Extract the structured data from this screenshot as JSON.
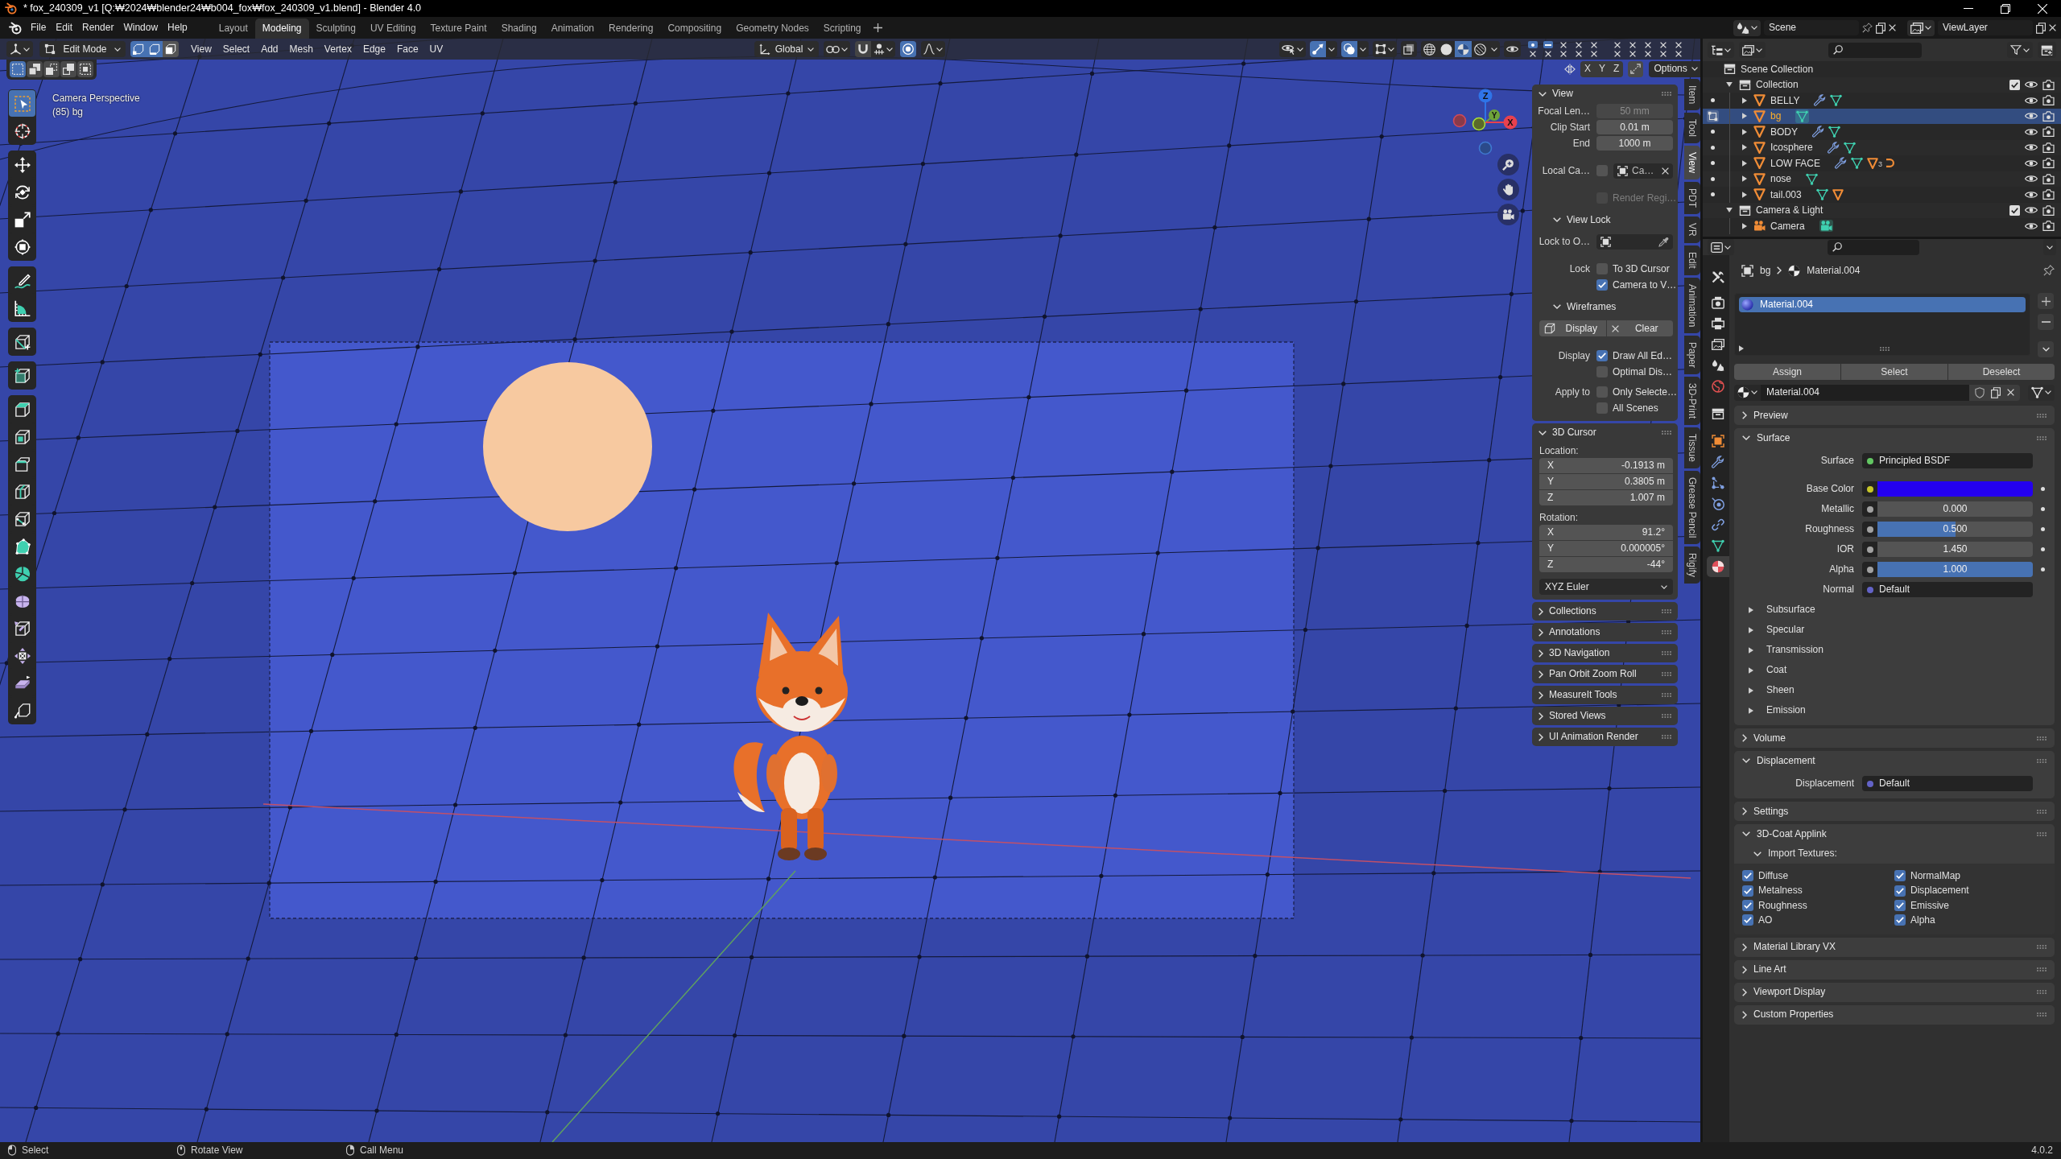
{
  "window": {
    "title": "* fox_240309_v1 [Q:₩2024₩blender24₩b004_fox₩fox_240309_v1.blend] - Blender 4.0"
  },
  "menu": [
    "File",
    "Edit",
    "Render",
    "Window",
    "Help"
  ],
  "workspaces": [
    {
      "label": "Layout",
      "selected": false
    },
    {
      "label": "Modeling",
      "selected": true
    },
    {
      "label": "Sculpting",
      "selected": false
    },
    {
      "label": "UV Editing",
      "selected": false
    },
    {
      "label": "Texture Paint",
      "selected": false
    },
    {
      "label": "Shading",
      "selected": false
    },
    {
      "label": "Animation",
      "selected": false
    },
    {
      "label": "Rendering",
      "selected": false
    },
    {
      "label": "Compositing",
      "selected": false
    },
    {
      "label": "Geometry Nodes",
      "selected": false
    },
    {
      "label": "Scripting",
      "selected": false
    }
  ],
  "scene": {
    "name": "Scene"
  },
  "view_layer": {
    "name": "ViewLayer"
  },
  "viewport": {
    "header": {
      "mode": "Edit Mode",
      "select_modes": [
        {
          "kind": "vertex",
          "selected": true
        },
        {
          "kind": "edge",
          "selected": true
        },
        {
          "kind": "face",
          "selected": false
        }
      ],
      "menus": [
        "View",
        "Select",
        "Add",
        "Mesh",
        "Vertex",
        "Edge",
        "Face",
        "UV"
      ],
      "orientation": "Global",
      "snapping": false,
      "proportional_editing": true,
      "gizmos": true,
      "overlays": true,
      "xray": false,
      "shading_modes": [
        {
          "kind": "wireframe",
          "selected": false
        },
        {
          "kind": "solid",
          "selected": false
        },
        {
          "kind": "material",
          "selected": true
        },
        {
          "kind": "rendered",
          "selected": false
        }
      ],
      "qcd_slots": [
        {
          "kind": "active"
        },
        {
          "kind": "occupied"
        },
        {
          "kind": "empty"
        },
        {
          "kind": "empty"
        },
        {
          "kind": "empty"
        },
        {
          "kind": "empty"
        },
        {
          "kind": "empty"
        },
        {
          "kind": "empty"
        },
        {
          "kind": "empty"
        },
        {
          "kind": "empty"
        },
        {
          "kind": "empty"
        },
        {
          "kind": "empty"
        },
        {
          "kind": "empty"
        },
        {
          "kind": "empty"
        },
        {
          "kind": "empty"
        },
        {
          "kind": "empty"
        },
        {
          "kind": "empty"
        },
        {
          "kind": "empty"
        },
        {
          "kind": "empty"
        },
        {
          "kind": "empty"
        }
      ]
    },
    "tool_header": {
      "select_ops": [
        {
          "kind": "set",
          "selected": true
        },
        {
          "kind": "extend",
          "selected": false
        },
        {
          "kind": "subtract",
          "selected": false
        },
        {
          "kind": "invert",
          "selected": false
        },
        {
          "kind": "intersect",
          "selected": false
        }
      ],
      "mirror_axes": [
        {
          "label": "X",
          "selected": false
        },
        {
          "label": "Y",
          "selected": false
        },
        {
          "label": "Z",
          "selected": false
        }
      ],
      "options": "Options"
    },
    "view_name": "Camera Perspective",
    "object_info": "(85) bg",
    "gizmo": {
      "axes": [
        {
          "label": "Z",
          "color": "#2f74e8"
        },
        {
          "label": "Y",
          "color": "#6ea33a"
        },
        {
          "label": "X",
          "color": "#e8414e"
        }
      ]
    },
    "tool_groups": [
      [
        {
          "kind": "select_box",
          "selected": true
        },
        {
          "kind": "cursor",
          "selected": false
        }
      ],
      [
        {
          "kind": "move",
          "selected": false
        },
        {
          "kind": "rotate",
          "selected": false
        },
        {
          "kind": "scale",
          "selected": false
        },
        {
          "kind": "transform",
          "selected": false
        }
      ],
      [
        {
          "kind": "annotate",
          "selected": false
        },
        {
          "kind": "measure",
          "selected": false
        }
      ],
      [
        {
          "kind": "cube_edit",
          "selected": false
        }
      ],
      [
        {
          "kind": "add_cube",
          "selected": false
        }
      ],
      [
        {
          "kind": "extrude",
          "selected": false
        },
        {
          "kind": "inset",
          "selected": false
        },
        {
          "kind": "bevel",
          "selected": false
        },
        {
          "kind": "loop_cut",
          "selected": false
        },
        {
          "kind": "knife",
          "selected": false
        },
        {
          "kind": "poly_build",
          "selected": false
        },
        {
          "kind": "spin",
          "selected": false
        },
        {
          "kind": "smooth",
          "selected": false
        },
        {
          "kind": "edge_slide",
          "selected": false
        },
        {
          "kind": "shrink",
          "selected": false
        },
        {
          "kind": "shear",
          "selected": false
        },
        {
          "kind": "rip",
          "selected": false
        }
      ]
    ],
    "sidebar": {
      "tabs": [
        {
          "label": "Item",
          "selected": false
        },
        {
          "label": "Tool",
          "selected": false
        },
        {
          "label": "View",
          "selected": true
        },
        {
          "label": "PDT",
          "selected": false
        },
        {
          "label": "VR",
          "selected": false
        },
        {
          "label": "Edit",
          "selected": false
        },
        {
          "label": "Animation",
          "selected": false
        },
        {
          "label": "Paper",
          "selected": false
        },
        {
          "label": "3D-Print",
          "selected": false
        },
        {
          "label": "Tissue",
          "selected": false
        },
        {
          "label": "Grease Pencil",
          "selected": false
        },
        {
          "label": "Rigify",
          "selected": false
        }
      ],
      "panels": [
        {
          "title": "View",
          "expanded": true,
          "rows": [
            {
              "kind": "number",
              "label": "Focal Len…",
              "value": "50 mm",
              "disabled": true
            },
            {
              "kind": "number",
              "label": "Clip Start",
              "value": "0.01 m",
              "disabled": false
            },
            {
              "kind": "number",
              "label": "End",
              "value": "1000 m",
              "disabled": false
            },
            {
              "kind": "object_field",
              "label": "Local Ca…",
              "checked": false,
              "value": "Ca…",
              "end_icon": {
                "kind": "clear"
              },
              "disabled": false
            },
            {
              "kind": "checkbox",
              "text": "Render Regi…",
              "checked": false,
              "disabled": true
            },
            {
              "kind": "subpanel",
              "title": "View Lock",
              "expanded": true
            },
            {
              "kind": "object_field",
              "label": "Lock to O…",
              "end_icon": {
                "kind": "eyedropper"
              },
              "disabled": true
            },
            {
              "kind": "checkbox",
              "label": "Lock",
              "text": "To 3D Cursor",
              "checked": false,
              "disabled": false
            },
            {
              "kind": "checkbox",
              "text": "Camera to V…",
              "checked": true,
              "disabled": false
            },
            {
              "kind": "subpanel",
              "title": "Wireframes",
              "expanded": true
            },
            {
              "kind": "buttons",
              "buttons": [
                "Display",
                "Clear"
              ]
            },
            {
              "kind": "checkbox",
              "label": "Display",
              "text": "Draw All Ed…",
              "checked": true,
              "disabled": false
            },
            {
              "kind": "checkbox",
              "text": "Optimal Dis…",
              "checked": false,
              "disabled": false
            },
            {
              "kind": "checkbox",
              "label": "Apply to",
              "text": "Only Selecte…",
              "checked": false,
              "disabled": false
            },
            {
              "kind": "checkbox",
              "text": "All Scenes",
              "checked": false,
              "disabled": false
            }
          ]
        },
        {
          "title": "3D Cursor",
          "expanded": true,
          "rows": [
            {
              "kind": "caption",
              "text": "Location:"
            },
            {
              "kind": "vector",
              "items": [
                {
                  "axis": "X",
                  "value": "-0.1913 m"
                },
                {
                  "axis": "Y",
                  "value": "0.3805 m"
                },
                {
                  "axis": "Z",
                  "value": "1.007 m"
                }
              ]
            },
            {
              "kind": "caption",
              "text": "Rotation:"
            },
            {
              "kind": "vector",
              "items": [
                {
                  "axis": "X",
                  "value": "91.2°"
                },
                {
                  "axis": "Y",
                  "value": "0.000005°"
                },
                {
                  "axis": "Z",
                  "value": "-44°"
                }
              ]
            },
            {
              "kind": "dropdown",
              "value": "XYZ Euler"
            }
          ]
        },
        {
          "title": "Collections",
          "expanded": false
        },
        {
          "title": "Annotations",
          "expanded": false
        },
        {
          "title": "3D Navigation",
          "expanded": false
        },
        {
          "title": "Pan Orbit Zoom Roll",
          "expanded": false
        },
        {
          "title": "MeasureIt Tools",
          "expanded": false
        },
        {
          "title": "Stored Views",
          "expanded": false
        },
        {
          "title": "UI Animation Render",
          "expanded": false
        }
      ]
    }
  },
  "outliner": {
    "tree": [
      {
        "label": "Scene Collection",
        "kind": "scene_collection",
        "children": [
          {
            "label": "Collection",
            "kind": "collection",
            "expanded": true,
            "checked": true,
            "visible": true,
            "children": [
              {
                "label": "BELLY",
                "kind": "mesh",
                "mode_icon": {
                  "kind": "dot"
                },
                "selected": false,
                "expanded": false,
                "visible": true,
                "badges": [
                  {
                    "kind": "modifier"
                  },
                  {
                    "kind": "mesh_data"
                  }
                ]
              },
              {
                "label": "bg",
                "kind": "mesh",
                "mode_icon": {
                  "kind": "edit"
                },
                "selected": true,
                "expanded": false,
                "visible": true,
                "badges": [
                  {
                    "kind": "mesh_data_active"
                  }
                ]
              },
              {
                "label": "BODY",
                "kind": "mesh",
                "mode_icon": {
                  "kind": "dot"
                },
                "selected": false,
                "expanded": false,
                "visible": true,
                "badges": [
                  {
                    "kind": "modifier"
                  },
                  {
                    "kind": "mesh_data"
                  }
                ]
              },
              {
                "label": "Icosphere",
                "kind": "mesh",
                "mode_icon": {
                  "kind": "dot"
                },
                "selected": false,
                "expanded": false,
                "visible": true,
                "badges": [
                  {
                    "kind": "modifier"
                  },
                  {
                    "kind": "mesh_data"
                  }
                ]
              },
              {
                "label": "LOW FACE",
                "kind": "mesh",
                "mode_icon": {
                  "kind": "dot"
                },
                "selected": false,
                "expanded": false,
                "visible": true,
                "badges": [
                  {
                    "kind": "modifier"
                  },
                  {
                    "kind": "mesh_data"
                  },
                  {
                    "kind": "child_objects",
                    "count": "3"
                  },
                  {
                    "kind": "curve"
                  }
                ]
              },
              {
                "label": "nose",
                "kind": "mesh",
                "mode_icon": {
                  "kind": "dot"
                },
                "selected": false,
                "expanded": false,
                "visible": true,
                "badges": [
                  {
                    "kind": "mesh_data"
                  }
                ]
              },
              {
                "label": "tail.003",
                "kind": "mesh",
                "mode_icon": {
                  "kind": "dot"
                },
                "selected": false,
                "expanded": false,
                "visible": true,
                "badges": [
                  {
                    "kind": "mesh_data"
                  },
                  {
                    "kind": "child_mesh"
                  }
                ]
              }
            ]
          },
          {
            "label": "Camera & Light",
            "kind": "collection",
            "expanded": true,
            "checked": true,
            "visible": true,
            "children": [
              {
                "label": "Camera",
                "kind": "camera",
                "selected": false,
                "expanded": false,
                "visible": true,
                "badges": [
                  {
                    "kind": "camera_data_active"
                  }
                ]
              }
            ]
          }
        ]
      }
    ]
  },
  "properties": {
    "tabs": [
      {
        "kind": "tool",
        "selected": false
      },
      {
        "kind": "render",
        "selected": false
      },
      {
        "kind": "output",
        "selected": false
      },
      {
        "kind": "view_layer",
        "selected": false
      },
      {
        "kind": "scene",
        "selected": false
      },
      {
        "kind": "world",
        "selected": false
      },
      {
        "kind": "collection",
        "selected": false
      },
      {
        "kind": "object",
        "selected": false
      },
      {
        "kind": "modifiers",
        "selected": false
      },
      {
        "kind": "particles",
        "selected": false
      },
      {
        "kind": "physics",
        "selected": false
      },
      {
        "kind": "constraints",
        "selected": false
      },
      {
        "kind": "data",
        "selected": false
      },
      {
        "kind": "material",
        "selected": true
      }
    ],
    "breadcrumb": {
      "object": "bg",
      "material": "Material.004"
    },
    "slots": [
      {
        "label": "Material.004",
        "selected": true
      }
    ],
    "slot_buttons": [
      "Assign",
      "Select",
      "Deselect"
    ],
    "material": "Material.004",
    "panels": [
      {
        "title": "Preview",
        "expanded": false
      },
      {
        "title": "Surface",
        "expanded": true,
        "rows": [
          {
            "kind": "socket",
            "label": "Surface",
            "color": "#63c763",
            "value": "Principled BSDF"
          },
          {
            "kind": "color",
            "label": "Base Color",
            "color": "#c7c729",
            "swatch": {
              "color": "#2400ef"
            }
          },
          {
            "kind": "slider",
            "label": "Metallic",
            "color": "#a1a1a1",
            "value": "0.000",
            "level": 0
          },
          {
            "kind": "slider",
            "label": "Roughness",
            "color": "#a1a1a1",
            "value": "0.500",
            "level": 0.5
          },
          {
            "kind": "number",
            "label": "IOR",
            "color": "#a1a1a1",
            "value": "1.450"
          },
          {
            "kind": "slider",
            "label": "Alpha",
            "color": "#a1a1a1",
            "value": "1.000",
            "level": 1
          },
          {
            "kind": "socket",
            "label": "Normal",
            "color": "#6363c7",
            "value": "Default"
          },
          {
            "kind": "group",
            "label": "Subsurface",
            "expanded": false
          },
          {
            "kind": "group",
            "label": "Specular",
            "expanded": false
          },
          {
            "kind": "group",
            "label": "Transmission",
            "expanded": false
          },
          {
            "kind": "group",
            "label": "Coat",
            "expanded": false
          },
          {
            "kind": "group",
            "label": "Sheen",
            "expanded": false
          },
          {
            "kind": "group",
            "label": "Emission",
            "expanded": false
          }
        ]
      },
      {
        "title": "Volume",
        "expanded": false
      },
      {
        "title": "Displacement",
        "expanded": true,
        "rows": [
          {
            "kind": "socket",
            "label": "Displacement",
            "color": "#6363c7",
            "value": "Default"
          }
        ]
      },
      {
        "title": "Settings",
        "expanded": false
      },
      {
        "title": "3D-Coat Applink",
        "expanded": true,
        "subpanel": {
          "title": "Import Textures:",
          "expanded": true
        },
        "checkboxes": [
          {
            "label": "Diffuse",
            "checked": true
          },
          {
            "label": "NormalMap",
            "checked": true
          },
          {
            "label": "Metalness",
            "checked": true
          },
          {
            "label": "Displacement",
            "checked": true
          },
          {
            "label": "Roughness",
            "checked": true
          },
          {
            "label": "Emissive",
            "checked": true
          },
          {
            "label": "AO",
            "checked": true
          },
          {
            "label": "Alpha",
            "checked": true
          }
        ]
      },
      {
        "title": "Material Library VX",
        "expanded": false
      },
      {
        "title": "Line Art",
        "expanded": false
      },
      {
        "title": "Viewport Display",
        "expanded": false
      },
      {
        "title": "Custom Properties",
        "expanded": false
      }
    ]
  },
  "status_bar": {
    "items": [
      {
        "kind": "mouse_left",
        "label": "Select"
      },
      {
        "kind": "mouse_middle",
        "label": "Rotate View"
      },
      {
        "kind": "mouse_right",
        "label": "Call Menu"
      }
    ],
    "version": "4.0.2"
  }
}
